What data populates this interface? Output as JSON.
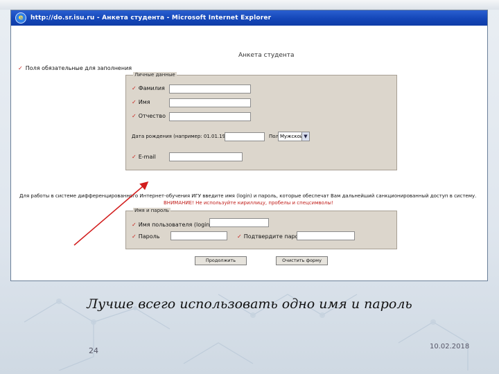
{
  "window": {
    "title": "http://do.sr.isu.ru - Анкета студента - Microsoft Internet Explorer"
  },
  "form": {
    "title": "Анкета студента",
    "required_note": "Поля обязательные для заполнения",
    "personal_group": {
      "legend": "Личные данные",
      "last_name_label": "Фамилия",
      "first_name_label": "Имя",
      "patronymic_label": "Отчество",
      "birth_date_label": "Дата рождения (например: 01.01.1980)",
      "gender_label": "Пол",
      "gender_value": "Мужской",
      "email_label": "E-mail"
    },
    "info_text": "Для работы в системе дифференцированного Интернет-обучения ИГУ введите имя (login) и пароль, которые обеспечат Вам дальнейший санкционированный доступ в систему.",
    "warning_text": "ВНИМАНИЕ! Не используйте кириллицу, пробелы и спецсимволы!",
    "account_group": {
      "legend": "Имя и пароль",
      "username_label": "Имя пользователя (login)",
      "password_label": "Пароль",
      "confirm_label": "Подтвердите пароль"
    },
    "buttons": {
      "continue": "Продолжить",
      "clear": "Очистить форму"
    }
  },
  "slide": {
    "caption": "Лучше всего использовать одно имя и пароль",
    "number": "24",
    "date": "10.02.2018"
  },
  "colors": {
    "titlebar": "#1446b8",
    "required_mark": "#c8201a",
    "annotation_arrow": "#d21c1c",
    "group_background": "#dcd6cc"
  }
}
